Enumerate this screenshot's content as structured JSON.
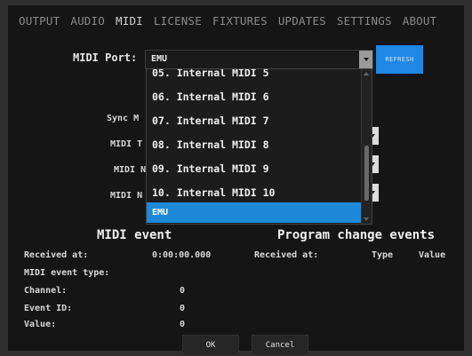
{
  "tabs": [
    "OUTPUT",
    "AUDIO",
    "MIDI",
    "LICENSE",
    "FIXTURES",
    "UPDATES",
    "SETTINGS",
    "ABOUT"
  ],
  "active_tab": "MIDI",
  "midi_port": {
    "label": "MIDI Port:",
    "selected_value": "EMU",
    "refresh_label": "REFRESH"
  },
  "dropdown": {
    "partial_top": "05. Internal MIDI 5",
    "items": [
      "06. Internal MIDI 6",
      "07. Internal MIDI 7",
      "08. Internal MIDI 8",
      "09. Internal MIDI 9",
      "10. Internal MIDI 10",
      "EMU"
    ],
    "selected": "EMU"
  },
  "hidden_labels": {
    "sync": "Sync M",
    "midi_t": "MIDI T",
    "midi_n1": "MIDI N",
    "midi_n2": "MIDI N"
  },
  "midi_event": {
    "title": "MIDI event",
    "received_label": "Received at:",
    "received_value": "0:00:00.000",
    "type_label": "MIDI event type:",
    "channel_label": "Channel:",
    "channel_value": "0",
    "event_id_label": "Event ID:",
    "event_id_value": "0",
    "value_label": "Value:",
    "value_value": "0"
  },
  "program_change": {
    "title": "Program change events",
    "received_label": "Received at:",
    "type_col": "Type",
    "value_col": "Value"
  },
  "buttons": {
    "ok": "OK",
    "cancel": "Cancel"
  },
  "colors": {
    "accent": "#1e88e5",
    "background": "#151515"
  }
}
